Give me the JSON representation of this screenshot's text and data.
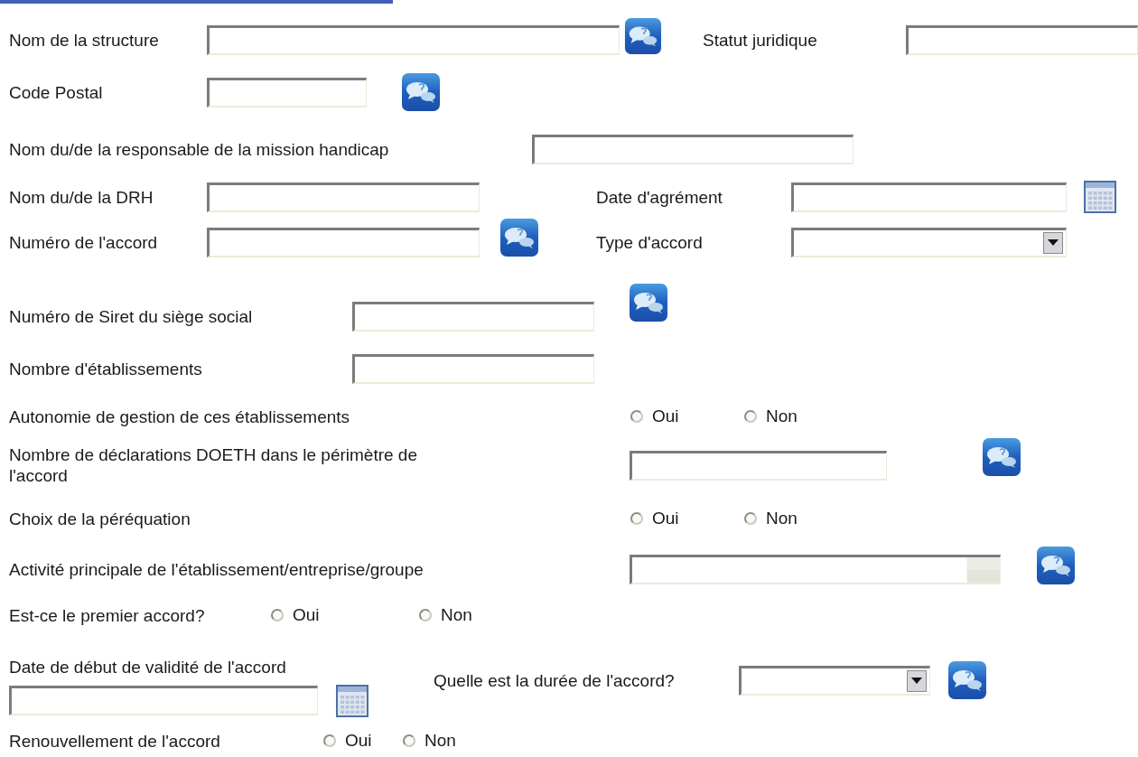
{
  "rows": [
    {
      "items": [
        {
          "kind": "label",
          "text": "Nom de la structure"
        },
        {
          "kind": "text_field"
        },
        {
          "kind": "help"
        },
        {
          "kind": "label",
          "text": "Statut juridique"
        },
        {
          "kind": "text_field"
        }
      ]
    },
    {
      "items": [
        {
          "kind": "label",
          "text": "Code Postal"
        },
        {
          "kind": "text_field"
        },
        {
          "kind": "help"
        }
      ]
    },
    {
      "items": [
        {
          "kind": "label",
          "text": "Nom du/de la responsable de la mission handicap"
        },
        {
          "kind": "text_field"
        }
      ]
    },
    {
      "items": [
        {
          "kind": "label",
          "text": "Nom du/de la DRH"
        },
        {
          "kind": "text_field"
        },
        {
          "kind": "label",
          "text": "Date d'agrément"
        },
        {
          "kind": "text_field"
        },
        {
          "kind": "calendar"
        }
      ]
    },
    {
      "items": [
        {
          "kind": "label",
          "text": "Numéro de l'accord"
        },
        {
          "kind": "text_field"
        },
        {
          "kind": "help"
        },
        {
          "kind": "label",
          "text": "Type d'accord"
        },
        {
          "kind": "select"
        }
      ]
    },
    {
      "items": [
        {
          "kind": "label",
          "text": "Numéro de Siret du siège social"
        },
        {
          "kind": "text_field"
        },
        {
          "kind": "help"
        }
      ]
    },
    {
      "items": [
        {
          "kind": "label",
          "text": "Nombre d'établissements"
        },
        {
          "kind": "text_field"
        }
      ]
    },
    {
      "items": [
        {
          "kind": "label",
          "text": "Autonomie de gestion de ces établissements"
        },
        {
          "kind": "radio_group",
          "options": [
            {
              "label": "Oui",
              "selected": false
            },
            {
              "label": "Non",
              "selected": false
            }
          ]
        }
      ]
    },
    {
      "items": [
        {
          "kind": "label",
          "text": "Nombre de déclarations DOETH dans le périmètre de l'accord"
        },
        {
          "kind": "text_field"
        },
        {
          "kind": "help"
        }
      ]
    },
    {
      "items": [
        {
          "kind": "label",
          "text": "Choix de la péréquation"
        },
        {
          "kind": "radio_group",
          "options": [
            {
              "label": "Oui",
              "selected": false
            },
            {
              "label": "Non",
              "selected": false
            }
          ]
        }
      ]
    },
    {
      "items": [
        {
          "kind": "label",
          "text": "Activité principale de l'établissement/entreprise/groupe"
        },
        {
          "kind": "combo"
        },
        {
          "kind": "help"
        }
      ]
    },
    {
      "items": [
        {
          "kind": "label",
          "text": "Est-ce le premier accord?"
        },
        {
          "kind": "radio_group",
          "options": [
            {
              "label": "Oui",
              "selected": false
            },
            {
              "label": "Non",
              "selected": false
            }
          ]
        }
      ]
    },
    {
      "items": [
        {
          "kind": "stack",
          "items": [
            {
              "kind": "label",
              "text": "Date de début de validité de l'accord"
            },
            {
              "kind": "text_field"
            },
            {
              "kind": "calendar"
            }
          ]
        },
        {
          "kind": "label",
          "text": "Quelle est la durée de l'accord?"
        },
        {
          "kind": "select"
        },
        {
          "kind": "help"
        }
      ]
    },
    {
      "items": [
        {
          "kind": "label",
          "text": "Renouvellement de l'accord"
        },
        {
          "kind": "radio_group",
          "options": [
            {
              "label": "Oui",
              "selected": false
            },
            {
              "label": "Non",
              "selected": false
            }
          ]
        }
      ]
    }
  ]
}
